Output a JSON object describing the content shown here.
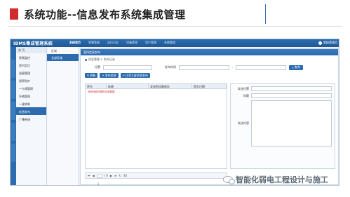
{
  "slide": {
    "title": "系统功能--信息发布系统集成管理"
  },
  "app": {
    "logo": "IBMS集成管理系统",
    "nav": [
      "系统首页",
      "智慧管理",
      "运行日志",
      "设备管理",
      "用户管理",
      "系统管理"
    ],
    "nav_active_index": 0,
    "user": "超级管理员",
    "left_rail": [
      "综合监控",
      "智能管理",
      "报警管理",
      "安全管理",
      "广播通讯"
    ],
    "sidebar_a": {
      "header": "首 页",
      "items": [
        "视频监控",
        "室内定位",
        "巡更管理",
        "周界防护",
        "一卡通管理",
        "车辆管理",
        "一键求助",
        "信息发布",
        "广播系统"
      ],
      "active_index": 7
    },
    "sidebar_b": {
      "header": "区域",
      "items": [
        "全部区域"
      ]
    },
    "panel_title": "室内信息发布",
    "breadcrumb": "信息管理 > 发布记录",
    "search": {
      "label_position": "位置",
      "label_time": "发布时间",
      "range_sep": "-",
      "button": "查询"
    },
    "toolbar": [
      "刷新",
      "发布信息",
      "LED大屏信息发布"
    ],
    "grid": {
      "columns": [
        "序号",
        "标题",
        "发送到设备地址",
        "提交日期"
      ],
      "empty_message": "没有找到匹配的记录数据"
    },
    "form": {
      "label_location": "发送位置",
      "label_title": "标题",
      "label_content": "发送内容"
    },
    "pager": {
      "page": "1",
      "total": "/ 0",
      "page_size": "30"
    }
  },
  "watermark": {
    "text": "智能化弱电工程设计与施工"
  },
  "colors": {
    "accent": "#d02a2a",
    "brand": "#2c6cae"
  }
}
